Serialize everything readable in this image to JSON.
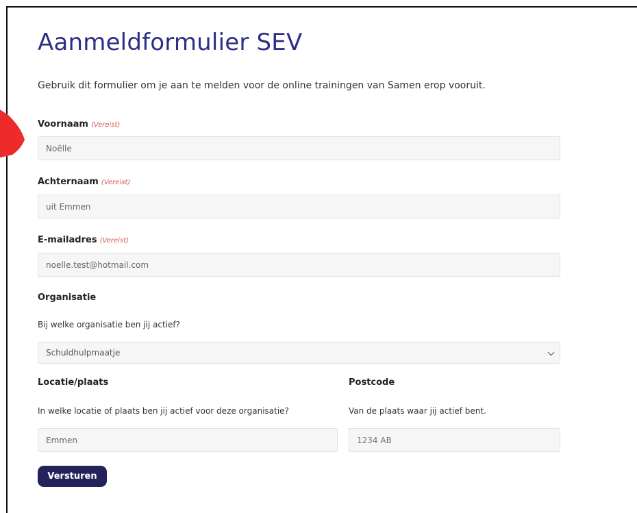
{
  "form": {
    "title": "Aanmeldformulier SEV",
    "intro": "Gebruik dit formulier om je aan te melden voor de online trainingen van Samen erop vooruit.",
    "required_label": "(Vereist)",
    "fields": {
      "firstname": {
        "label": "Voornaam",
        "value": "Noëlle"
      },
      "lastname": {
        "label": "Achternaam",
        "value": "uit Emmen"
      },
      "email": {
        "label": "E-mailadres",
        "value": "noelle.test@hotmail.com"
      },
      "organisation": {
        "label": "Organisatie",
        "description": "Bij welke organisatie ben jij actief?",
        "selected": "Schuldhulpmaatje"
      },
      "location": {
        "label": "Locatie/plaats",
        "description": "In welke locatie of plaats ben jij actief voor deze organisatie?",
        "value": "Emmen"
      },
      "postcode": {
        "label": "Postcode",
        "description": "Van de plaats waar jij actief bent.",
        "placeholder": "1234 AB"
      }
    },
    "submit_label": "Versturen"
  },
  "colors": {
    "title": "#2b2f86",
    "required": "#d9534f",
    "button": "#24225a",
    "input_bg": "#f6f6f6"
  }
}
